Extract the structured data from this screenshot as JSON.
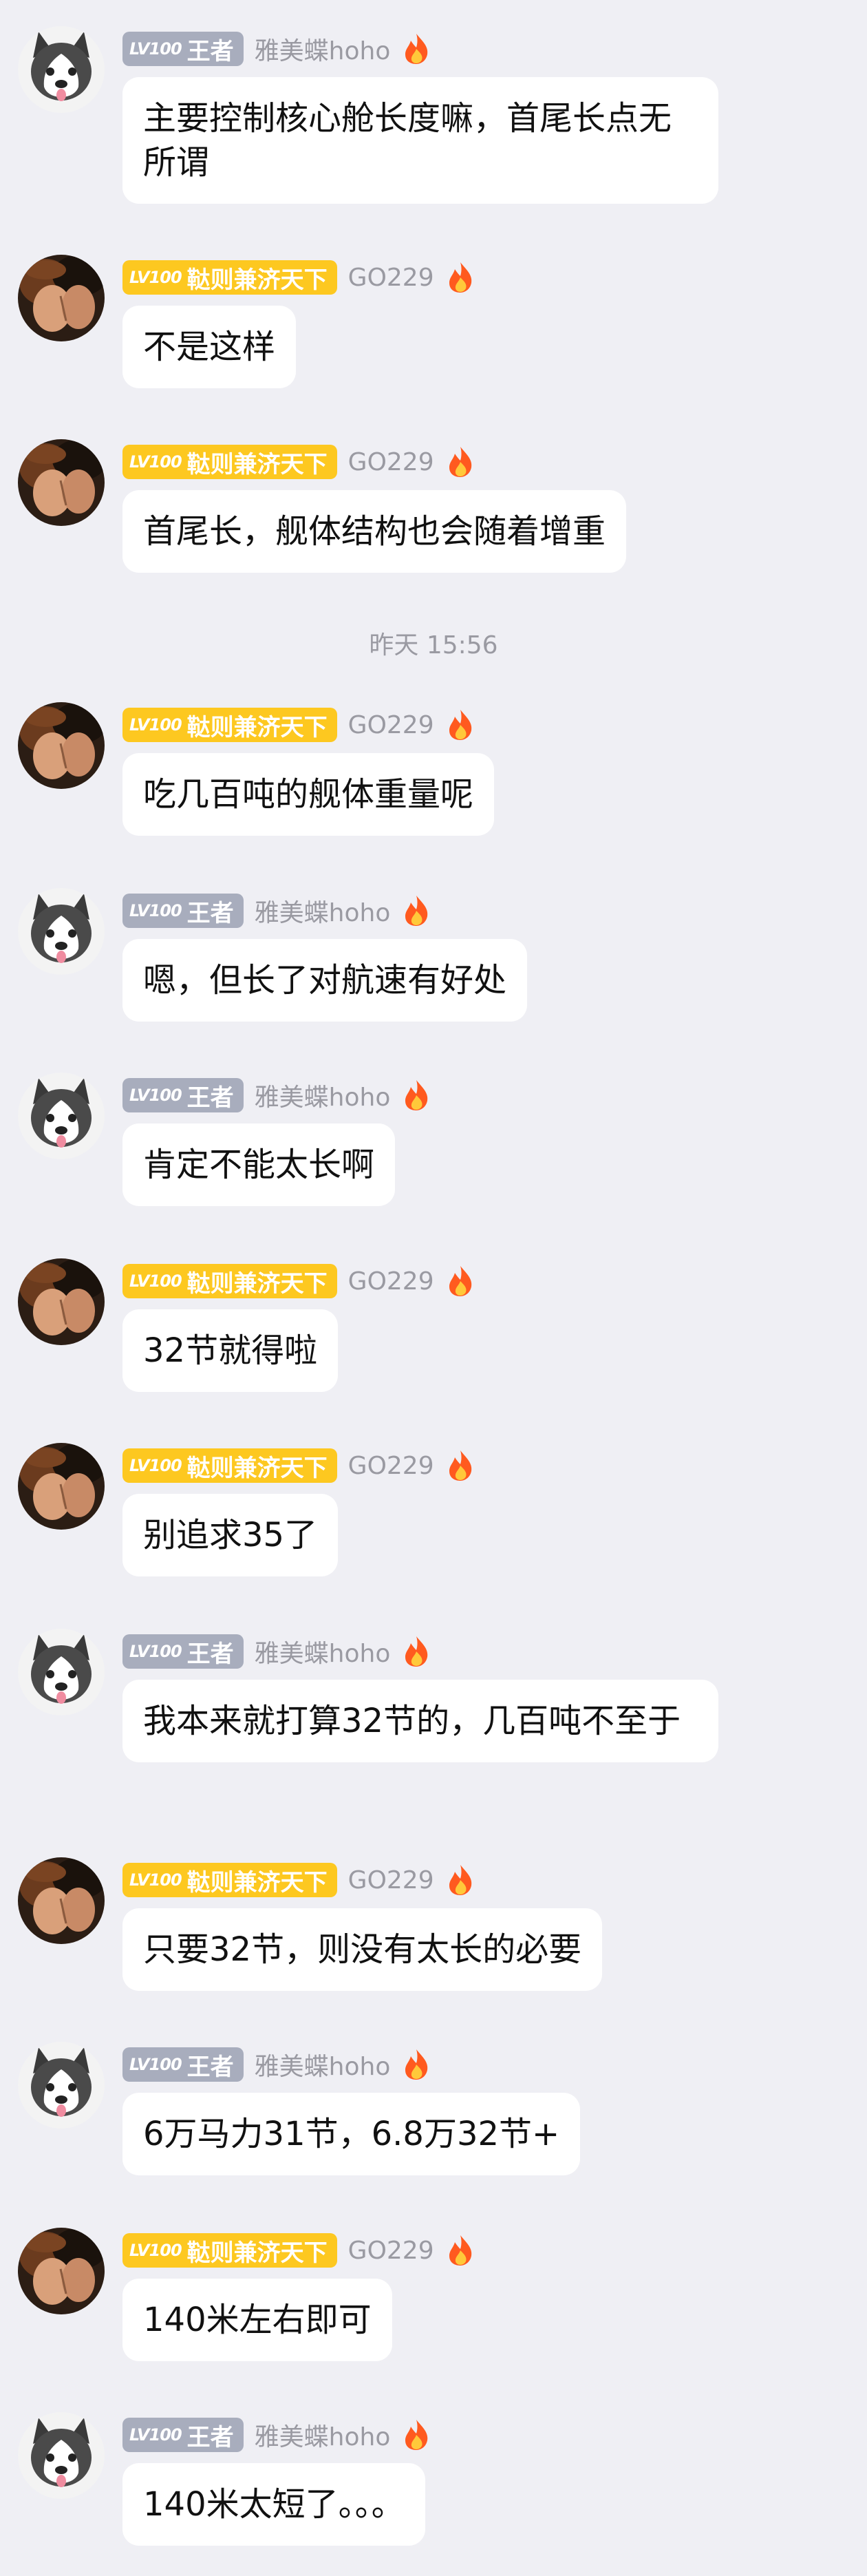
{
  "users": {
    "husky": {
      "level": "LV100",
      "title": "王者",
      "name": "雅美蝶hoho"
    },
    "go": {
      "level": "LV100",
      "title": "鞑则兼济天下",
      "name": "GO229"
    }
  },
  "timestamp": "昨天 15:56",
  "messages": [
    {
      "text": "主要控制核心舱长度嘛，首尾长点无所谓"
    },
    {
      "text": "不是这样"
    },
    {
      "text": "首尾长，舰体结构也会随着增重"
    },
    {
      "text": "吃几百吨的舰体重量呢"
    },
    {
      "text": "嗯，但长了对航速有好处"
    },
    {
      "text": "肯定不能太长啊"
    },
    {
      "text": "32节就得啦"
    },
    {
      "text": "别追求35了"
    },
    {
      "text": "我本来就打算32节的，几百吨不至于"
    },
    {
      "text": "只要32节，则没有太长的必要"
    },
    {
      "text": "6万马力31节，6.8万32节+"
    },
    {
      "text": "140米左右即可"
    },
    {
      "text": "140米太短了。。。"
    }
  ],
  "colors": {
    "background": "#efeff4",
    "bubble": "#ffffff",
    "badge_gray": "#a8adbd",
    "badge_gold": "#fdc820",
    "name_gray": "#9a9aa2"
  }
}
